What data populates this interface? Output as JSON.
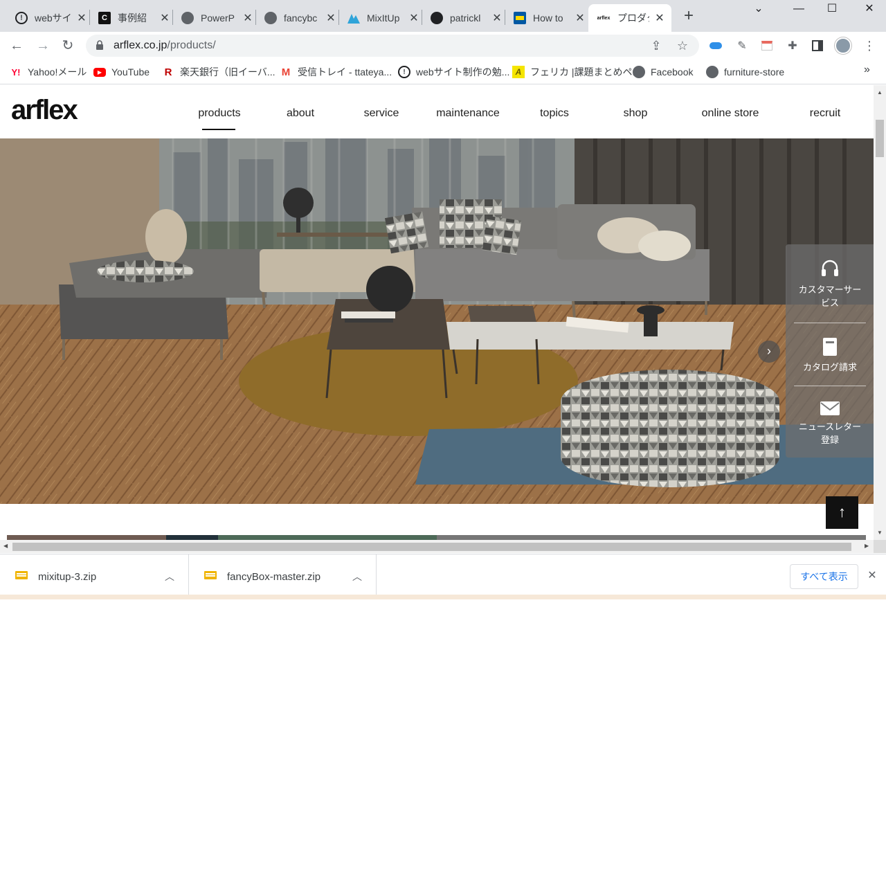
{
  "browser": {
    "tabs": [
      {
        "title": "webサイ",
        "icon": "web-favicon",
        "active": false
      },
      {
        "title": "事例紹",
        "icon": "c-favicon",
        "active": false
      },
      {
        "title": "PowerP",
        "icon": "globe-icon",
        "active": false
      },
      {
        "title": "fancybc",
        "icon": "globe-icon",
        "active": false
      },
      {
        "title": "MixItUp",
        "icon": "mixitup-favicon",
        "active": false
      },
      {
        "title": "patrickl",
        "icon": "github-icon",
        "active": false
      },
      {
        "title": "How to",
        "icon": "ikea-favicon",
        "active": false
      },
      {
        "title": "プロダク",
        "icon": "arflex-favicon",
        "active": true
      }
    ],
    "new_tab_label": "+",
    "address": {
      "domain": "arflex.co.jp",
      "path": "/products/"
    },
    "bookmarks": [
      {
        "label": "Yahoo!メール",
        "icon": "yahoo-icon"
      },
      {
        "label": "YouTube",
        "icon": "youtube-icon"
      },
      {
        "label": "楽天銀行（旧イーバ...",
        "icon": "rakuten-icon"
      },
      {
        "label": "受信トレイ - ttateya...",
        "icon": "gmail-icon"
      },
      {
        "label": "webサイト制作の勉...",
        "icon": "web-favicon"
      },
      {
        "label": "フェリカ |課題まとめペ...",
        "icon": "felica-icon"
      },
      {
        "label": "Facebook",
        "icon": "globe-icon"
      },
      {
        "label": "furniture-store",
        "icon": "globe-icon"
      }
    ],
    "bookmarks_more": "»"
  },
  "site": {
    "logo": "arflex",
    "nav": [
      "products",
      "about",
      "service",
      "maintenance",
      "topics",
      "shop",
      "online store",
      "recruit"
    ],
    "active_nav": "products",
    "side_panel": {
      "customer_service": "カスタマーサービス",
      "catalog": "カタログ請求",
      "newsletter": "ニュースレター登録"
    },
    "slider_next": "›",
    "to_top": "↑"
  },
  "downloads": {
    "items": [
      {
        "name": "mixitup-3.zip"
      },
      {
        "name": "fancyBox-master.zip"
      }
    ],
    "show_all": "すべて表示",
    "close": "✕"
  },
  "colors": {
    "accent_link": "#1a73e8",
    "header_text": "#222222",
    "panel_bg": "#6e6e6e"
  }
}
